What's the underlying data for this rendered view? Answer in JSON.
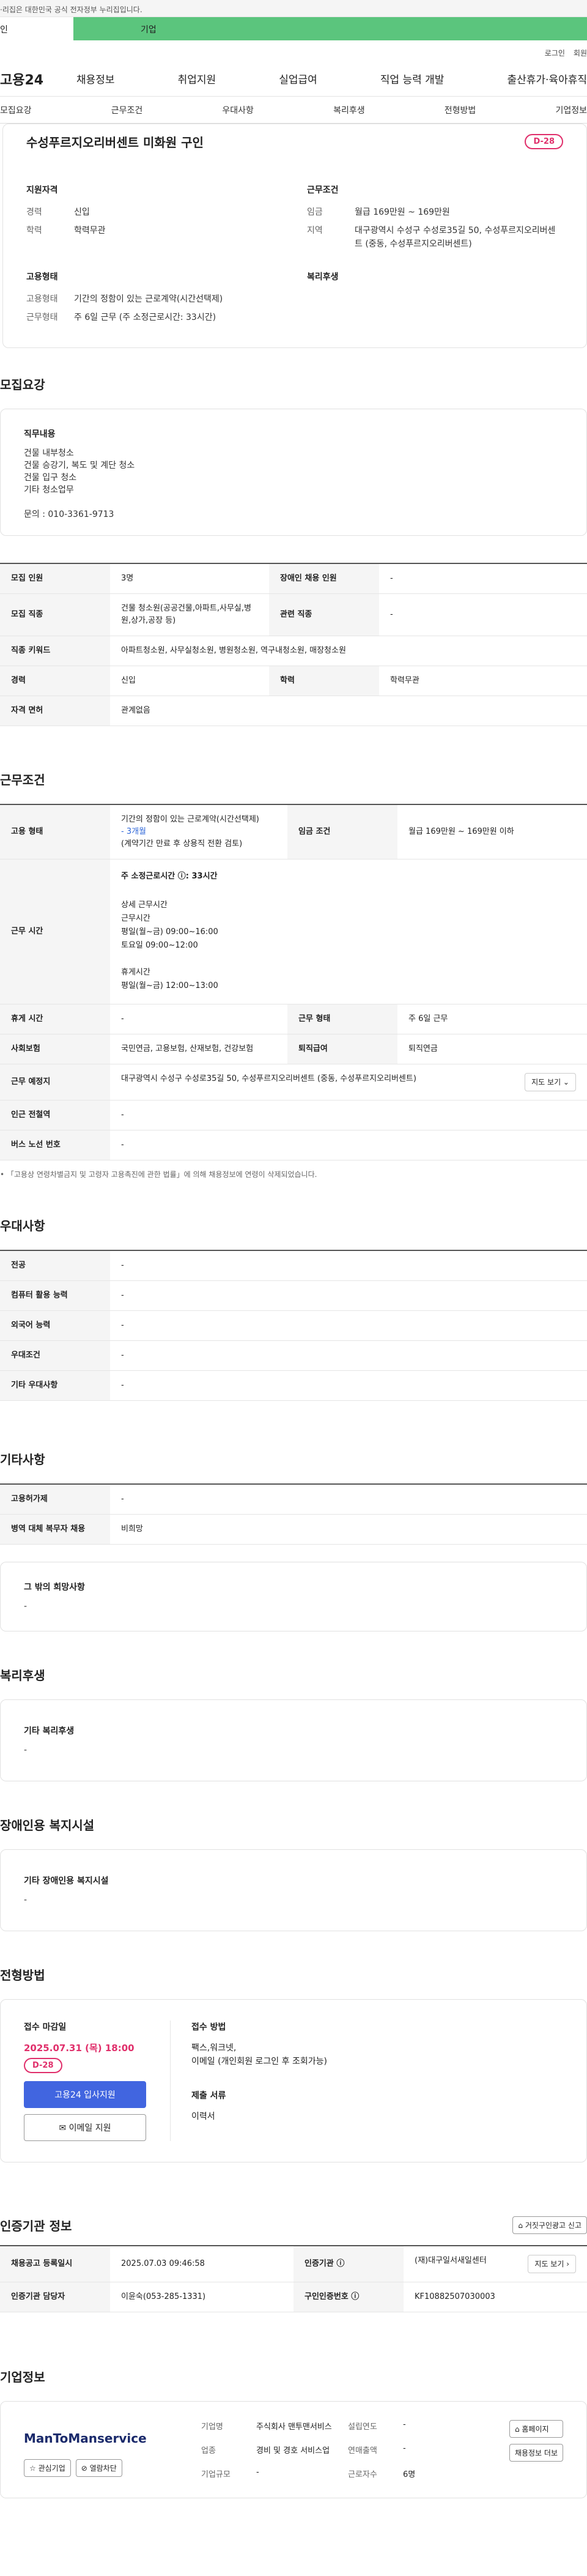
{
  "gov_banner": "·리집은 대한민국 공식 전자정부 누리집입니다.",
  "mode_tabs": {
    "personal": "인",
    "company": "기업"
  },
  "util_links": [
    "로그인",
    "회원"
  ],
  "gnb": {
    "logo": "고용24",
    "menu": [
      "채용정보",
      "취업지원",
      "실업급여",
      "직업 능력 개발",
      "출산휴가·육아휴직"
    ]
  },
  "anchor_nav": [
    "모집요강",
    "근무조건",
    "우대사항",
    "복리후생",
    "전형방법",
    "기업정보"
  ],
  "summary": {
    "title": "수성푸르지오리버센트 미화원 구인",
    "dday": "D-28",
    "qualification": {
      "heading": "지원자격",
      "rows": [
        {
          "k": "경력",
          "v": "신입"
        },
        {
          "k": "학력",
          "v": "학력무관"
        }
      ]
    },
    "conditions": {
      "heading": "근무조건",
      "rows": [
        {
          "k": "임금",
          "v": "월급 169만원 ~ 169만원"
        },
        {
          "k": "지역",
          "v": "대구광역시 수성구 수성로35길 50, 수성푸르지오리버센트 (중동, 수성푸르지오리버센트)"
        }
      ]
    },
    "employment": {
      "heading": "고용형태",
      "rows": [
        {
          "k": "고용형태",
          "v": "기간의 정함이 있는 근로계약(시간선택제)"
        },
        {
          "k": "근무형태",
          "v": "주 6일 근무 (주 소정근로시간: 33시간)"
        }
      ]
    },
    "welfare": {
      "heading": "복리후생"
    }
  },
  "recruit": {
    "title": "모집요강",
    "duty_label": "직무내용",
    "duty_text": "건물 내부청소\n건물 승강기, 복도 및 계단 청소\n건물 입구 청소\n기타 청소업무\n\n문의 : 010-3361-9713",
    "table": {
      "count_k": "모집 인원",
      "count_v": "3명",
      "disabled_k": "장애인 채용 인원",
      "disabled_v": "-",
      "job_k": "모집 직종",
      "job_v": "건물 청소원(공공건물,아파트,사무실,병원,상가,공장 등)",
      "related_k": "관련 직종",
      "related_v": "-",
      "keyword_k": "직종 키워드",
      "keyword_v": "아파트청소원, 사무실청소원, 병원청소원, 역구내청소원, 매장청소원",
      "career_k": "경력",
      "career_v": "신입",
      "edu_k": "학력",
      "edu_v": "학력무관",
      "license_k": "자격 면허",
      "license_v": "관계없음"
    }
  },
  "work": {
    "title": "근무조건",
    "emp_k": "고용 형태",
    "emp_v1": "기간의 정함이 있는 근로계약(시간선택제)",
    "emp_v2": "- 3개월",
    "emp_v3": "(계약기간 만료 후 상용직 전환 검토)",
    "wage_k": "임금 조건",
    "wage_v": "월급 169만원 ~ 169만원 이하",
    "hours_k": "근무 시간",
    "hours_v": "주 소정근로시간 ⓘ: 33시간",
    "hours_detail": "상세 근무시간\n근무시간\n평일(월~금) 09:00~16:00\n토요일 09:00~12:00\n\n휴게시간\n평일(월~금) 12:00~13:00",
    "break_k": "휴게 시간",
    "break_v": "-",
    "shift_k": "근무 형태",
    "shift_v": "주 6일 근무",
    "insurance_k": "사회보험",
    "insurance_v": "국민연금, 고용보험, 산재보험, 건강보험",
    "retire_k": "퇴직급여",
    "retire_v": "퇴직연금",
    "place_k": "근무 예정지",
    "place_v": "대구광역시 수성구 수성로35길 50, 수성푸르지오리버센트 (중동, 수성푸르지오리버센트)",
    "map_btn": "지도 보기 ⌄",
    "subway_k": "인근 전철역",
    "subway_v": "-",
    "bus_k": "버스 노선 번호",
    "bus_v": "-",
    "note": "• 「고용상 연령차별금지 및 고령자 고용촉진에 관한 법률」에 의해 채용정보에 연령이 삭제되었습니다."
  },
  "pref": {
    "title": "우대사항",
    "rows": [
      {
        "k": "전공",
        "v": "-"
      },
      {
        "k": "컴퓨터 활용 능력",
        "v": "-"
      },
      {
        "k": "외국어 능력",
        "v": "-"
      },
      {
        "k": "우대조건",
        "v": "-"
      },
      {
        "k": "기타 우대사항",
        "v": "-"
      }
    ]
  },
  "etc": {
    "title": "기타사항",
    "rows": [
      {
        "k": "고용허가제",
        "v": "-"
      },
      {
        "k": "병역 대체 복무자 채용",
        "v": "비희망"
      }
    ],
    "card_label": "그 밖의 희망사항",
    "card_body": "-"
  },
  "benefit": {
    "title": "복리후생",
    "card_label": "기타 복리후생",
    "card_body": "-"
  },
  "disabled": {
    "title": "장애인용 복지시설",
    "card_label": "기타 장애인용 복지시설",
    "card_body": "-"
  },
  "apply": {
    "title": "전형방법",
    "deadline_label": "접수 마감일",
    "deadline": "2025.07.31 (목) 18:00",
    "dday": "D-28",
    "apply_btn": "고용24 입사지원",
    "email_btn": "✉ 이메일 지원",
    "method_label": "접수 방법",
    "method_text": "팩스,워크넷,\n이메일 (개인회원 로그인 후 조회가능)",
    "docs_label": "제출 서류",
    "docs_text": "이력서"
  },
  "agency": {
    "title": "인증기관 정보",
    "report_btn": "⌂ 거짓구인광고 신고",
    "reg_k": "채용공고 등록일시",
    "reg_v": "2025.07.03 09:46:58",
    "org_k": "인증기관 ⓘ",
    "org_v": "(재)대구일서새일센터",
    "manager_k": "인증기관 담당자",
    "manager_v": "이윤숙(053-285-1331)",
    "num_k": "구인인증번호 ⓘ",
    "num_v": "KF10882507030003",
    "map_btn": "지도 보기 ›"
  },
  "company": {
    "title": "기업정보",
    "logo": "ManToManservice",
    "fav_btn": "☆ 관심기업",
    "block_btn": "⊘ 열람차단",
    "type_k": "기업명",
    "type_v": "주식회사 맨투맨서비스",
    "year_k": "설립연도",
    "year_v": "-",
    "biz_k": "업종",
    "biz_v": "경비 및 경호 서비스업",
    "sales_k": "연매출액",
    "sales_v": "-",
    "emp_k": "근로자수",
    "emp_v": "6명",
    "size_k": "기업규모",
    "size_v": "-",
    "homepage_btn": "⌂ 홈페이지",
    "recruit_btn": "채용정보 더보"
  }
}
